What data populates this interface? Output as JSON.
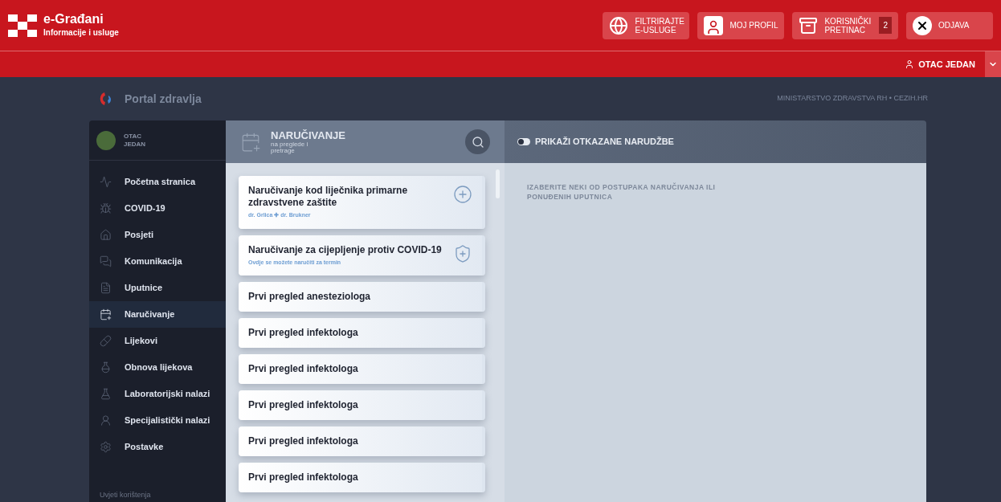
{
  "brand": {
    "title": "e-Građani",
    "subtitle": "Informacije i usluge"
  },
  "top_actions": [
    {
      "kind": "filter",
      "label": "FILTRIRAJTE E-USLUGE"
    },
    {
      "kind": "profile",
      "label": "MOJ PROFIL"
    },
    {
      "kind": "inbox",
      "label": "KORISNIČKI PRETINAC",
      "count": "2"
    },
    {
      "kind": "logout",
      "label": "ODJAVA"
    }
  ],
  "user_bar": {
    "name": "OTAC JEDAN"
  },
  "portal": {
    "title": "Portal zdravlja",
    "source": "MINISTARSTVO ZDRAVSTVA RH • CEZIH.HR"
  },
  "sidebar": {
    "user": "OTAC JEDAN",
    "items": [
      {
        "label": "Početna stranica",
        "selected": false
      },
      {
        "label": "COVID-19",
        "selected": false
      },
      {
        "label": "Posjeti",
        "selected": false
      },
      {
        "label": "Komunikacija",
        "selected": false
      },
      {
        "label": "Uputnice",
        "selected": false
      },
      {
        "label": "Naručivanje",
        "selected": true
      },
      {
        "label": "Lijekovi",
        "selected": false
      },
      {
        "label": "Obnova lijekova",
        "selected": false
      },
      {
        "label": "Laboratorijski nalazi",
        "selected": false
      },
      {
        "label": "Specijalistički nalazi",
        "selected": false
      },
      {
        "label": "Postavke",
        "selected": false
      }
    ],
    "footer": "Uvjeti korištenja"
  },
  "section": {
    "title": "NARUČIVANJE",
    "subtitle": "na preglede i pretrage"
  },
  "show_cancelled": {
    "label": "PRIKAŽI OTKAZANE NARUDŽBE",
    "on": false
  },
  "procedures": [
    {
      "kind": "primary",
      "title": "Naručivanje kod liječnika primarne zdravstvene zaštite",
      "note": "dr. Grlica ✚ dr. Brukner"
    },
    {
      "kind": "vaccine",
      "title": "Naručivanje za cijepljenje protiv COVID-19",
      "note": "Ovdje se možete naručiti za termin"
    },
    {
      "kind": "plain",
      "title": "Prvi pregled anesteziologa"
    },
    {
      "kind": "plain",
      "title": "Prvi pregled infektologa"
    },
    {
      "kind": "plain",
      "title": "Prvi pregled infektologa"
    },
    {
      "kind": "plain",
      "title": "Prvi pregled infektologa"
    },
    {
      "kind": "plain",
      "title": "Prvi pregled infektologa"
    },
    {
      "kind": "plain",
      "title": "Prvi pregled infektologa"
    }
  ],
  "detail_hint": "IZABERITE NEKI OD POSTUPAKA NARUČIVANJA ILI PONUĐENIH UPUTNICA"
}
